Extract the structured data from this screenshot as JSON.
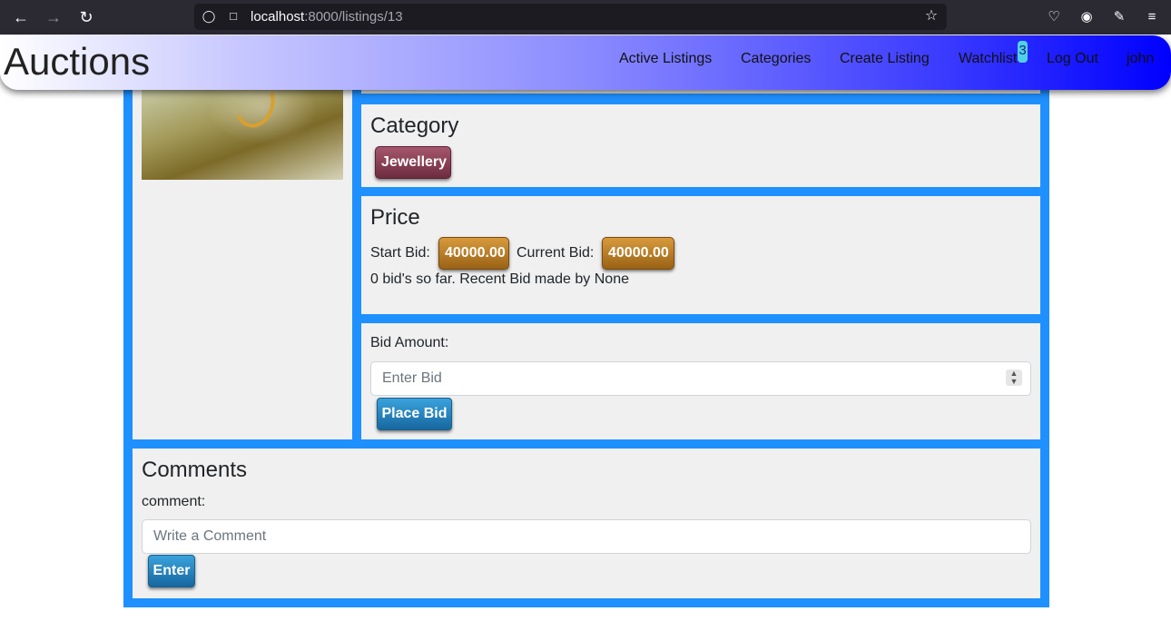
{
  "browser": {
    "url_host": "localhost",
    "url_path": ":8000/listings/13"
  },
  "navbar": {
    "brand": "Auctions",
    "links": {
      "active_listings": "Active Listings",
      "categories": "Categories",
      "create_listing": "Create Listing",
      "watchlist": "Watchlist",
      "log_out": "Log Out",
      "user": "john"
    },
    "watchlist_count": "3"
  },
  "listing": {
    "category_heading": "Category",
    "category_value": "Jewellery",
    "price_heading": "Price",
    "start_bid_label": "Start Bid:",
    "start_bid_value": "40000.00",
    "current_bid_label": "Current Bid:",
    "current_bid_value": "40000.00",
    "bid_summary": "0 bid's so far. Recent Bid made by None",
    "bid_amount_label": "Bid Amount:",
    "bid_placeholder": "Enter Bid",
    "place_bid_label": "Place Bid"
  },
  "comments": {
    "heading": "Comments",
    "comment_label": "comment:",
    "comment_placeholder": "Write a Comment",
    "enter_label": "Enter"
  },
  "colors": {
    "container_accent": "#1e90ff",
    "category_badge": "#8a3e55",
    "price_badge": "#b97d27",
    "button_blue": "#2385c2"
  }
}
